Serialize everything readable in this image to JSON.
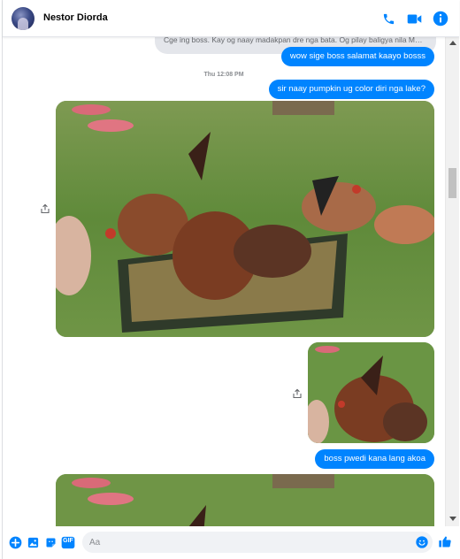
{
  "header": {
    "contact_name": "Nestor Diorda",
    "icons": [
      "phone-icon",
      "video-camera-icon",
      "info-icon"
    ],
    "accent_color": "#0084ff"
  },
  "messages": {
    "partial_incoming": "Cge ing boss. Kay og naay madakpan dre nga bata. Og pilay baligya nila M…",
    "outgoing_1": "wow sige boss salamat kaayo bosss",
    "timestamp": "Thu 12:08 PM",
    "outgoing_2": "sir naay pumpkin ug color diri nga lake?",
    "outgoing_3": "boss pwedi kana lang akoa"
  },
  "photos": {
    "photo_1": "chickens-eating-from-tray-photo",
    "photo_2": "chicken-closeup-photo",
    "photo_3": "chickens-on-grass-photo"
  },
  "composer": {
    "placeholder": "Aa",
    "icons": [
      "plus-icon",
      "image-icon",
      "sticker-icon",
      "gif-icon",
      "emoji-icon",
      "like-icon"
    ],
    "gif_label": "GIF"
  }
}
